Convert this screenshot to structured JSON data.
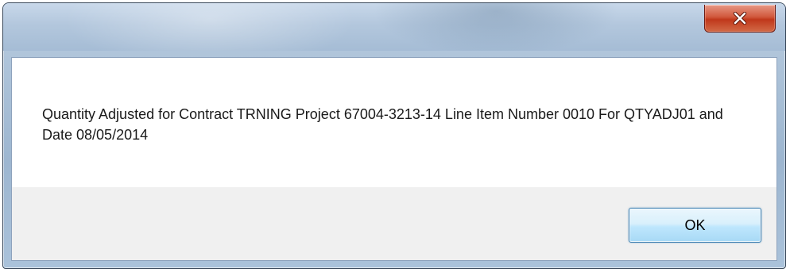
{
  "dialog": {
    "title": "",
    "close_icon": "close-icon",
    "message": "Quantity Adjusted for Contract TRNING Project 67004-3213-14 Line Item Number 0010 For QTYADJ01 and Date 08/05/2014",
    "ok_label": "OK"
  },
  "colors": {
    "close_button": "#c7432a",
    "ok_border": "#3c7fb1",
    "button_area": "#f0f0f0"
  }
}
